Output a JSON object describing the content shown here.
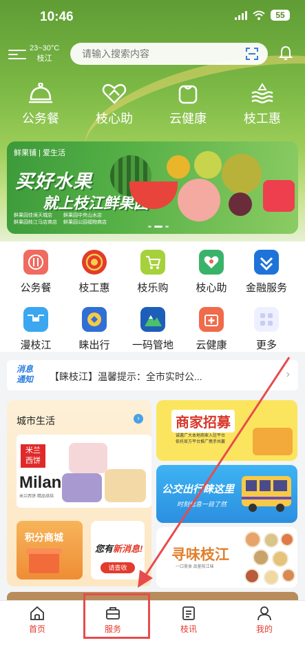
{
  "status_bar": {
    "time": "10:46",
    "battery": "55"
  },
  "header": {
    "weather_temp": "23~30°C",
    "weather_location": "枝江",
    "search_placeholder": "请输入搜索内容"
  },
  "feature_shortcuts": [
    {
      "label": "公务餐",
      "icon": "cloche-icon"
    },
    {
      "label": "枝心助",
      "icon": "heart-hands-icon"
    },
    {
      "label": "云健康",
      "icon": "square-bag-icon"
    },
    {
      "label": "枝工惠",
      "icon": "waves-icon"
    }
  ],
  "banner": {
    "brand": "鲜果铺 | 爱生活",
    "headline_1": "买好水果",
    "headline_2": "就上枝江鲜果园",
    "stores_left": [
      "鲜果园佳境天城店",
      "鲜果园枝江马店商店"
    ],
    "stores_right": [
      "鲜果园中央山水店",
      "鲜果园公园福物商店"
    ]
  },
  "services": [
    {
      "label": "公务餐",
      "icon": "utensils-icon",
      "color": "#ef6b60"
    },
    {
      "label": "枝工惠",
      "icon": "union-emblem-icon",
      "color": "#e33b2c"
    },
    {
      "label": "枝乐购",
      "icon": "cart-icon",
      "color": "#a6d13a"
    },
    {
      "label": "枝心助",
      "icon": "care-icon",
      "color": "#3ab36a"
    },
    {
      "label": "金融服务",
      "icon": "bank-icon",
      "color": "#1e73d9"
    },
    {
      "label": "漫枝江",
      "icon": "drone-icon",
      "color": "#3aa7f0"
    },
    {
      "label": "睐出行",
      "icon": "travel-icon",
      "color": "#2f6fd6"
    },
    {
      "label": "一码管地",
      "icon": "mountain-icon",
      "color": "#1d5fb8"
    },
    {
      "label": "云健康",
      "icon": "medical-kit-icon",
      "color": "#ef6b4c"
    },
    {
      "label": "更多",
      "icon": "more-grid-icon",
      "color": "#eef0ff"
    }
  ],
  "notice": {
    "tag_line1": "消息",
    "tag_line2": "通知",
    "text": "【睐枝江】温馨提示：全市实时公..."
  },
  "city_life": {
    "title": "城市生活",
    "milan_logo_line1": "米兰",
    "milan_logo_line2": "西饼",
    "milan_brand": "Milan",
    "milan_sub": "米兰西饼·精品烘焙",
    "points_title": "积分商城",
    "newmsg_text_1": "您有",
    "newmsg_text_2": "新消息!",
    "newmsg_button": "请查收"
  },
  "promo_cards": {
    "merchant_title": "商家招募",
    "merchant_sub_1": "诚邀广大本地商家入驻平台",
    "merchant_sub_2": "依托官方平台推广携手共赢",
    "bus_title": "公交出行睐这里",
    "bus_sub": "时刻信息一目了然",
    "flavor_title": "寻味枝江",
    "flavor_sub": "一口美食 品鉴枝江味"
  },
  "tabbar": [
    {
      "label": "首页",
      "icon": "home-icon",
      "active": true
    },
    {
      "label": "服务",
      "icon": "briefcase-icon",
      "active": false
    },
    {
      "label": "枝讯",
      "icon": "news-icon",
      "active": false
    },
    {
      "label": "我的",
      "icon": "person-icon",
      "active": false
    }
  ],
  "colors": {
    "accent_red": "#e33b2c",
    "hero_green": "#7bb845",
    "annotation_red": "#e74c4c"
  }
}
